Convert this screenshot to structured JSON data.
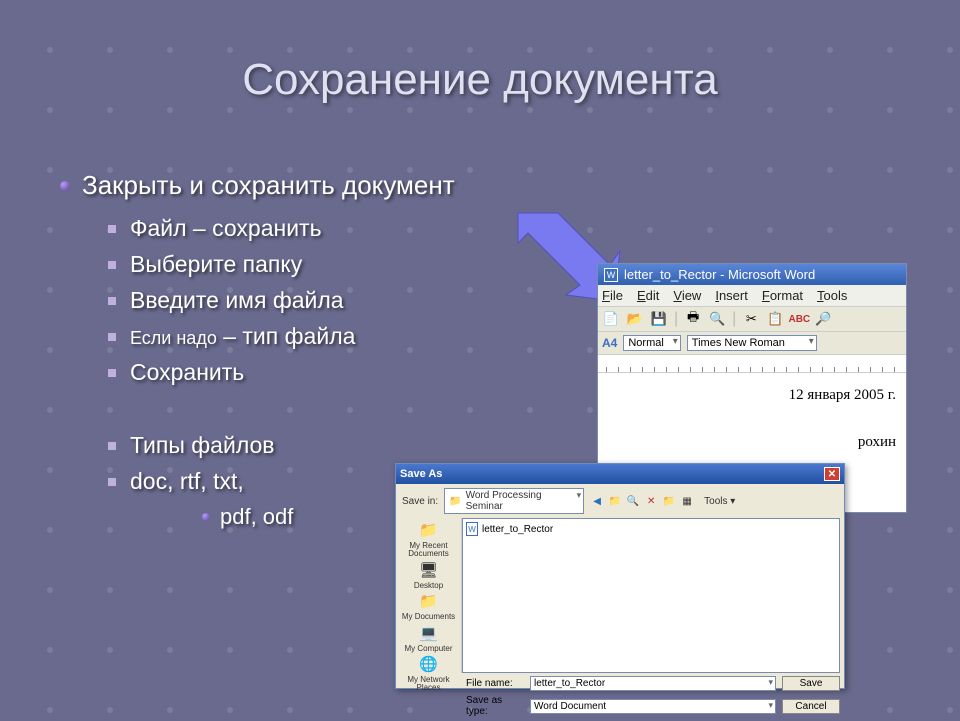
{
  "title": "Сохранение документа",
  "main_bullet": "Закрыть и сохранить документ",
  "sub": {
    "s0": "Файл – сохранить",
    "s1": "Выберите папку",
    "s2": "Введите имя файла",
    "s3_prefix": "Если надо",
    "s3_rest": " – тип файла",
    "s4": "Сохранить",
    "s5": "Типы файлов",
    "s6": "doc, rtf, txt,",
    "s7": "pdf, odf"
  },
  "word": {
    "title": "letter_to_Rector - Microsoft Word",
    "menu": {
      "file": "File",
      "edit": "Edit",
      "view": "View",
      "insert": "Insert",
      "format": "Format",
      "tools": "Tools"
    },
    "style_label": "Normal",
    "font_label": "Times New Roman",
    "aa": "A4",
    "doc_date": "12 января 2005 г.",
    "doc_name": "рохин"
  },
  "saveas": {
    "title": "Save As",
    "savein_label": "Save in:",
    "savein_value": "Word Processing Seminar",
    "tools_label": "Tools",
    "file_item": "letter_to_Rector",
    "places": {
      "recent": "My Recent Documents",
      "desktop": "Desktop",
      "mydocs": "My Documents",
      "mycomp": "My Computer",
      "mynet": "My Network Places"
    },
    "filename_label": "File name:",
    "filename_value": "letter_to_Rector",
    "saveastype_label": "Save as type:",
    "saveastype_value": "Word Document",
    "save_btn": "Save",
    "cancel_btn": "Cancel"
  }
}
